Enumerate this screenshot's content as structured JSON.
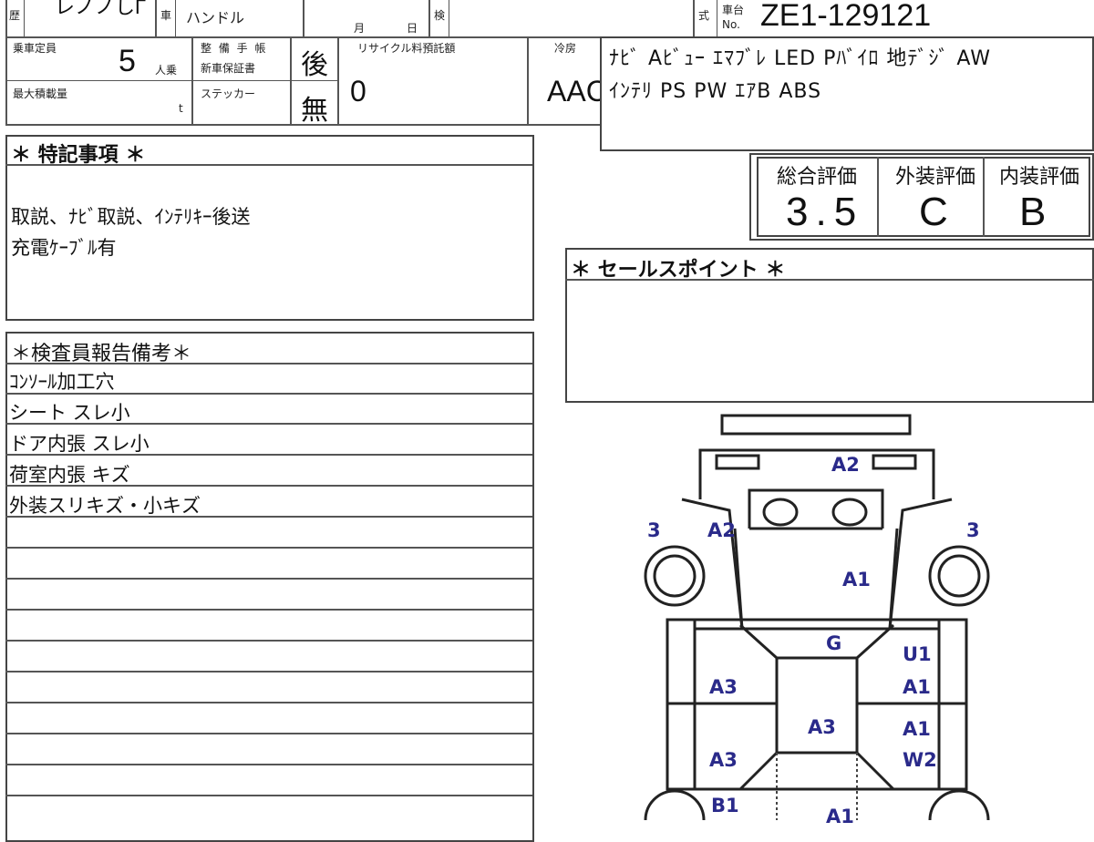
{
  "header": {
    "history_label": "歴",
    "model_partial": "レノノしГ",
    "handle_prefix": "車",
    "handle_label": "ハンドル",
    "date_month": "月",
    "date_day": "日",
    "inspection_label": "検",
    "shiki_label": "式",
    "chassis_label_top": "車台",
    "chassis_label_bottom": "No.",
    "chassis_number": "ZE1-129121"
  },
  "specs": {
    "capacity_label": "乗車定員",
    "capacity_value": "5",
    "capacity_unit": "人乗",
    "maintenance_label_1": "整 備 手 帳",
    "maintenance_label_2": "新車保証書",
    "maintenance_value": "後",
    "recycle_label": "リサイクル料預託額",
    "recycle_value": "0",
    "max_load_label": "最大積載量",
    "max_load_unit": "t",
    "sticker_label": "ステッカー",
    "sticker_value": "無",
    "aircon_label": "冷房",
    "aircon_value": "AAC",
    "equipment_line1": "ﾅﾋﾞ Aﾋﾞｭｰ ｴﾏﾌﾞﾚ LED Pﾊﾞｲﾛ 地ﾃﾞｼﾞ AW",
    "equipment_line2": "ｲﾝﾃﾘ PS PW ｴｱB ABS"
  },
  "special_notes": {
    "title": "＊ 特記事項 ＊",
    "line1": "取説、ﾅﾋﾞ取説、ｲﾝﾃﾘｷｰ後送",
    "line2": "充電ｹｰﾌﾞﾙ有"
  },
  "ratings": {
    "overall_label": "総合評価",
    "overall_value": "3.5",
    "exterior_label": "外装評価",
    "exterior_value": "C",
    "interior_label": "内装評価",
    "interior_value": "B"
  },
  "sales_points": {
    "title": "＊ セールスポイント ＊"
  },
  "inspector_report": {
    "title": "＊検査員報告備考＊",
    "items": [
      "ｺﾝｿｰﾙ加工穴",
      "シート スレ小",
      "ドア内張 スレ小",
      "荷室内張 キズ",
      "外装スリキズ・小キズ"
    ]
  },
  "damage_map": {
    "front_bumper": "A2",
    "front_left_fender": "A2",
    "left_front_tire_mark": "3",
    "right_front_tire_mark": "3",
    "hood": "A1",
    "windshield": "G",
    "roof": "A3",
    "left_front_door": "A3",
    "left_rear_door": "A3",
    "right_front_pillar": "U1",
    "right_front_door": "A1",
    "right_rear_door_a": "A1",
    "right_rear_door_w": "W2",
    "left_rear_quarter": "B1",
    "rear_center": "A1"
  }
}
